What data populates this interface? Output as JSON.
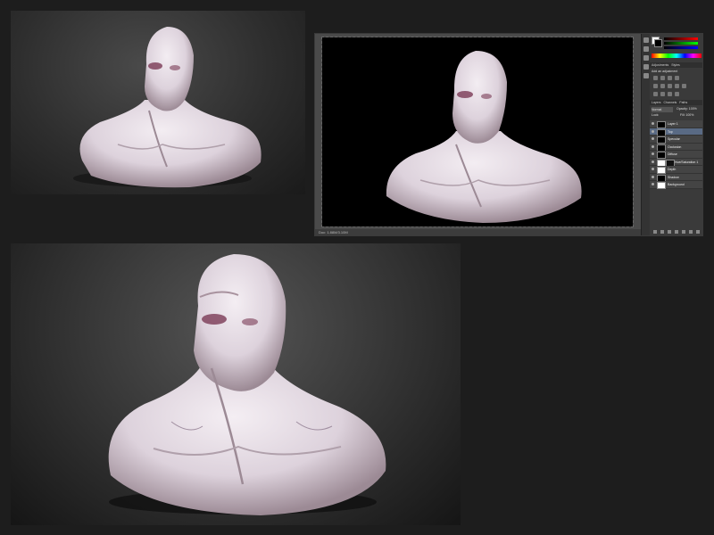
{
  "photoshop": {
    "status_text": "Doc: 1.88M/3.10M",
    "panels": {
      "adjustments_tabs": [
        "Adjustments",
        "Styles"
      ],
      "add_adjustment_label": "Add an adjustment",
      "layers_tabs": [
        "Layers",
        "Channels",
        "Paths"
      ],
      "blend_mode": "Normal",
      "opacity_label": "Opacity: 100%",
      "fill_label": "Fill: 100%",
      "lock_label": "Lock:",
      "layers": [
        {
          "name": "Layer 1",
          "thumb": "black",
          "mask": false,
          "selected": false
        },
        {
          "name": "Top",
          "thumb": "black",
          "mask": false,
          "selected": true
        },
        {
          "name": "Specular",
          "thumb": "black",
          "mask": false,
          "selected": false
        },
        {
          "name": "Occlusion",
          "thumb": "black",
          "mask": false,
          "selected": false
        },
        {
          "name": "Diffuse",
          "thumb": "black",
          "mask": false,
          "selected": false
        },
        {
          "name": "Hue/Saturation 1",
          "thumb": "white",
          "mask": true,
          "selected": false
        },
        {
          "name": "Depth",
          "thumb": "white",
          "mask": false,
          "selected": false
        },
        {
          "name": "Shadow",
          "thumb": "black",
          "mask": false,
          "selected": false
        },
        {
          "name": "Background",
          "thumb": "white",
          "mask": false,
          "selected": false
        }
      ]
    }
  },
  "colors": {
    "skin": "#e6dde6",
    "skin_shadow": "#a8929e",
    "eye_socket": "#7a3a55",
    "canvas_black": "#000000",
    "layer_selected": "#596a84"
  }
}
